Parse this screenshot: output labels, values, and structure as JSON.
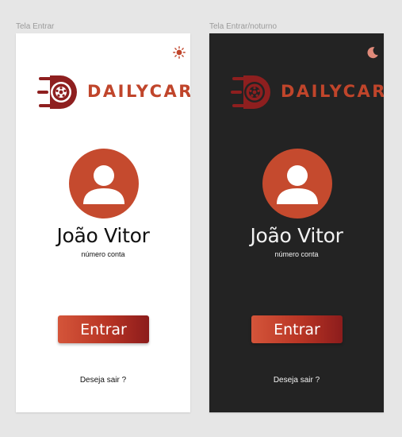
{
  "colors": {
    "canvas": "#e6e6e6",
    "brand": "#c0452b",
    "avatar": "#c54a2e",
    "button_start": "#d4553a",
    "button_end": "#8c1c1c",
    "light_background": "#ffffff",
    "dark_background": "#232323"
  },
  "frames": {
    "light": {
      "label": "Tela Entrar",
      "theme_icon": "sun-icon",
      "logo_text": "DAILYCAR",
      "user_name": "João Vitor",
      "account_label": "número conta",
      "enter_label": "Entrar",
      "exit_label": "Deseja sair ?"
    },
    "dark": {
      "label": "Tela Entrar/noturno",
      "theme_icon": "moon-icon",
      "logo_text": "DAILYCAR",
      "user_name": "João Vitor",
      "account_label": "número conta",
      "enter_label": "Entrar",
      "exit_label": "Deseja sair ?"
    }
  }
}
